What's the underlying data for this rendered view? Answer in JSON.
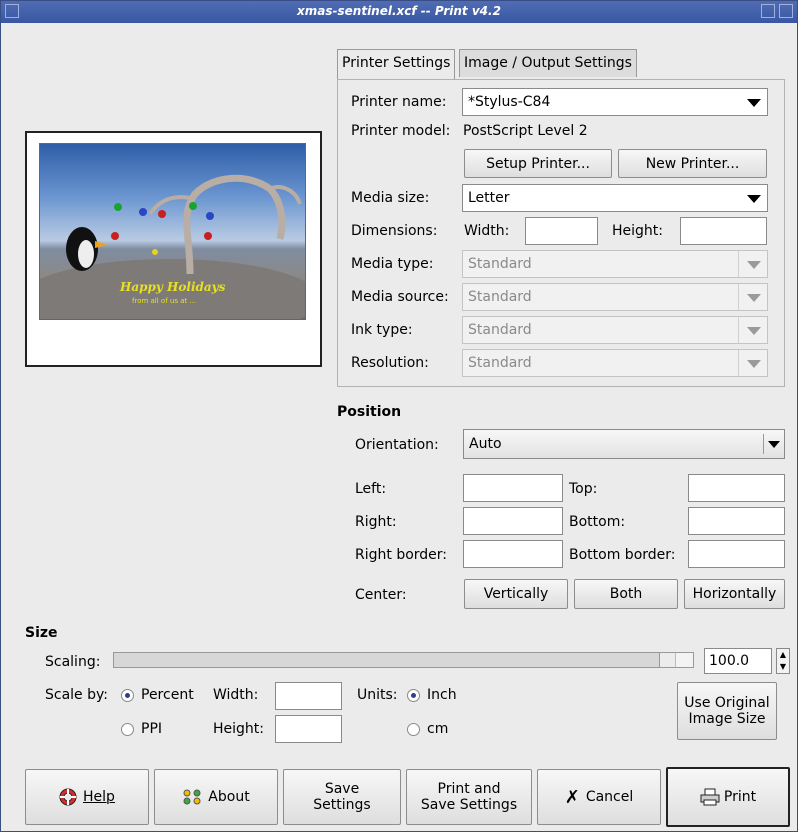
{
  "window": {
    "title": "xmas-sentinel.xcf -- Print v4.2"
  },
  "tabs": [
    {
      "label": "Printer Settings"
    },
    {
      "label": "Image / Output Settings"
    }
  ],
  "printer": {
    "name_label": "Printer name:",
    "name_value": "*Stylus-C84",
    "model_label": "Printer model:",
    "model_value": "PostScript Level 2",
    "setup_button": "Setup Printer...",
    "new_button": "New Printer...",
    "media_size_label": "Media size:",
    "media_size_value": "Letter",
    "dimensions_label": "Dimensions:",
    "width_label": "Width:",
    "height_label": "Height:",
    "media_type_label": "Media type:",
    "media_type_value": "Standard",
    "media_source_label": "Media source:",
    "media_source_value": "Standard",
    "ink_type_label": "Ink type:",
    "ink_type_value": "Standard",
    "resolution_label": "Resolution:",
    "resolution_value": "Standard"
  },
  "preview": {
    "greeting": "Happy Holidays",
    "subtext": "from all of us at ..."
  },
  "position": {
    "heading": "Position",
    "orientation_label": "Orientation:",
    "orientation_value": "Auto",
    "left_label": "Left:",
    "top_label": "Top:",
    "right_label": "Right:",
    "bottom_label": "Bottom:",
    "right_border_label": "Right border:",
    "bottom_border_label": "Bottom border:",
    "center_label": "Center:",
    "vertically_button": "Vertically",
    "both_button": "Both",
    "horizontally_button": "Horizontally"
  },
  "size": {
    "heading": "Size",
    "scaling_label": "Scaling:",
    "scaling_value": "100.0",
    "scale_by_label": "Scale by:",
    "percent_label": "Percent",
    "ppi_label": "PPI",
    "width_label": "Width:",
    "height_label": "Height:",
    "units_label": "Units:",
    "inch_label": "Inch",
    "cm_label": "cm",
    "use_original_button_line1": "Use Original",
    "use_original_button_line2": "Image Size"
  },
  "buttons": {
    "help": "Help",
    "about": "About",
    "save_settings_l1": "Save",
    "save_settings_l2": "Settings",
    "print_save_l1": "Print and",
    "print_save_l2": "Save Settings",
    "cancel": "Cancel",
    "print": "Print"
  }
}
